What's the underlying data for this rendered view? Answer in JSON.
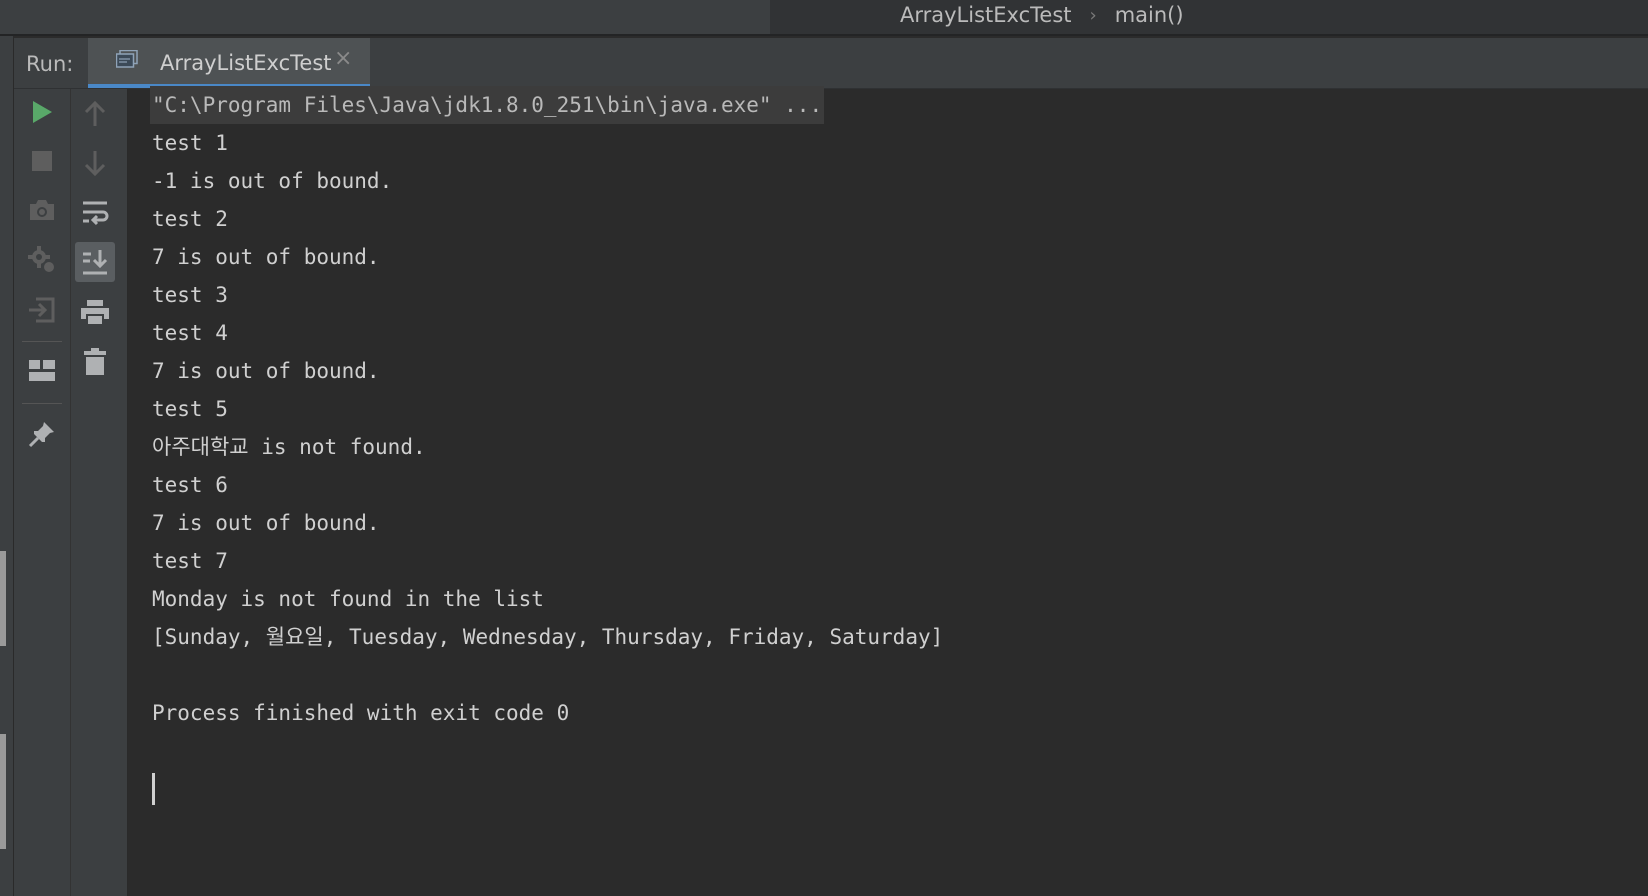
{
  "breadcrumb": {
    "file": "ArrayListExcTest",
    "method": "main()"
  },
  "run_panel": {
    "label": "Run:",
    "tab_label": "ArrayListExcTest",
    "tab_close_glyph": "×"
  },
  "left_toolbar": [
    {
      "icon": "run-icon",
      "color": "#59a869"
    },
    {
      "icon": "stop-icon",
      "color": "#6e6e6e"
    },
    {
      "icon": "camera-icon",
      "color": "#6e6e6e"
    },
    {
      "icon": "debug-settings-icon",
      "color": "#6e6e6e"
    },
    {
      "icon": "exit-icon",
      "color": "#6e6e6e"
    },
    {
      "icon": "layout-icon",
      "color": "#afb1b3"
    },
    {
      "icon": "pin-icon",
      "color": "#afb1b3"
    }
  ],
  "right_toolbar": [
    {
      "icon": "up-arrow-icon",
      "color": "#6e6e6e"
    },
    {
      "icon": "down-arrow-icon",
      "color": "#6e6e6e"
    },
    {
      "icon": "soft-wrap-icon",
      "color": "#afb1b3"
    },
    {
      "icon": "scroll-to-end-icon",
      "color": "#afb1b3",
      "active": true
    },
    {
      "icon": "print-icon",
      "color": "#afb1b3"
    },
    {
      "icon": "trash-icon",
      "color": "#afb1b3"
    }
  ],
  "console": {
    "command": "\"C:\\Program Files\\Java\\jdk1.8.0_251\\bin\\java.exe\" ...",
    "lines": [
      "test 1",
      "-1 is out of bound.",
      "test 2",
      "7 is out of bound.",
      "test 3",
      "test 4",
      "7 is out of bound.",
      "test 5",
      "아주대학교 is not found.",
      "test 6",
      "7 is out of bound.",
      "test 7",
      "Monday is not found in the list",
      "[Sunday, 월요일, Tuesday, Wednesday, Thursday, Friday, Saturday]",
      "",
      "Process finished with exit code 0"
    ]
  },
  "colors": {
    "background": "#2b2b2b",
    "panel": "#3c3f41",
    "accent": "#4a88c7",
    "run_green": "#59a869"
  }
}
